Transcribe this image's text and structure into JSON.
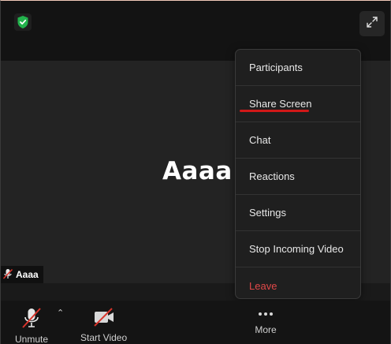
{
  "participant": {
    "name": "Aaaa",
    "tag": "Aaaa"
  },
  "menu": {
    "items": [
      {
        "label": "Participants"
      },
      {
        "label": "Share Screen"
      },
      {
        "label": "Chat"
      },
      {
        "label": "Reactions"
      },
      {
        "label": "Settings"
      },
      {
        "label": "Stop Incoming Video"
      },
      {
        "label": "Leave"
      }
    ]
  },
  "toolbar": {
    "unmute_label": "Unmute",
    "start_video_label": "Start Video",
    "more_label": "More"
  },
  "icons": {
    "security": "shield-check-icon",
    "fullscreen": "expand-icon",
    "mic": "mic-off-icon",
    "video": "video-off-icon",
    "more": "ellipsis-icon",
    "audio_options": "caret-up-icon"
  },
  "colors": {
    "security_green": "#22b24c",
    "leave_red": "#e04848",
    "mute_red": "#d9342b",
    "annotation_red": "#d11818"
  }
}
